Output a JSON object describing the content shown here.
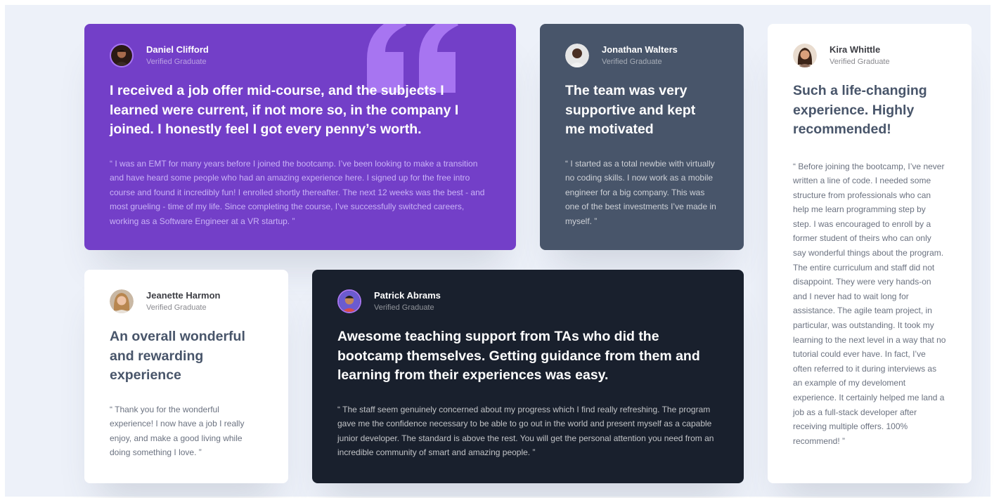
{
  "colors": {
    "background": "#edf1f9",
    "purple": "#733fc8",
    "grayish_blue": "#48556a",
    "dark_blue": "#19202d",
    "white": "#ffffff",
    "quote_accent": "#a775f1"
  },
  "decorations": {
    "quote_icon": "quotation-mark-icon"
  },
  "testimonials": [
    {
      "name": "Daniel Clifford",
      "role": "Verified Graduate",
      "headline": "I received a job offer mid-course, and the subjects I learned were current, if not more so, in the company I joined. I honestly feel I got every penny’s worth.",
      "body": "“ I was an EMT for many years before I joined the bootcamp. I’ve been looking to make a transition and have heard some people who had an amazing experience here. I signed up for the free intro course and found it incredibly fun! I enrolled shortly thereafter. The next 12 weeks was the  best - and most grueling - time of my life. Since completing the course, I’ve successfully switched careers, working as a Software Engineer at a VR startup. ”"
    },
    {
      "name": "Jonathan Walters",
      "role": "Verified Graduate",
      "headline": "The team was very supportive and kept me motivated",
      "body": "“ I started as a total newbie with virtually no coding skills. I now work as a mobile engineer for a big company. This was one of the best investments I’ve made in myself. ”"
    },
    {
      "name": "Kira Whittle",
      "role": "Verified Graduate",
      "headline": "Such a life-changing experience. Highly recommended!",
      "body": "“ Before joining the bootcamp, I’ve never written a line of code. I needed some structure from professionals who can help me learn programming step by step. I was encouraged to enroll by a former student of theirs who can only say wonderful things about the program. The entire curriculum and staff did not disappoint. They were very hands-on and I never had to wait long for assistance. The agile team project, in particular, was outstanding. It took my learning to the next level in a way that no tutorial could ever have. In fact, I’ve often referred to it during interviews as an example of my develoment experience. It certainly helped me land a job as a full-stack developer after receiving multiple offers. 100% recommend! ”"
    },
    {
      "name": "Jeanette Harmon",
      "role": "Verified Graduate",
      "headline": "An overall wonderful and rewarding experience",
      "body": "“ Thank you for the wonderful experience! I now have a job I really enjoy, and make a good living while doing something I love. ”"
    },
    {
      "name": "Patrick Abrams",
      "role": "Verified Graduate",
      "headline": "Awesome teaching support from TAs who did the bootcamp themselves. Getting guidance from them and learning from their experiences was easy.",
      "body": "“ The staff seem genuinely concerned about my progress which I find really refreshing. The program gave me the confidence necessary to be able to go out in the world and present myself as a capable junior developer. The standard is above the rest. You will get the personal attention you need from an incredible community of smart and amazing people. ”"
    }
  ]
}
